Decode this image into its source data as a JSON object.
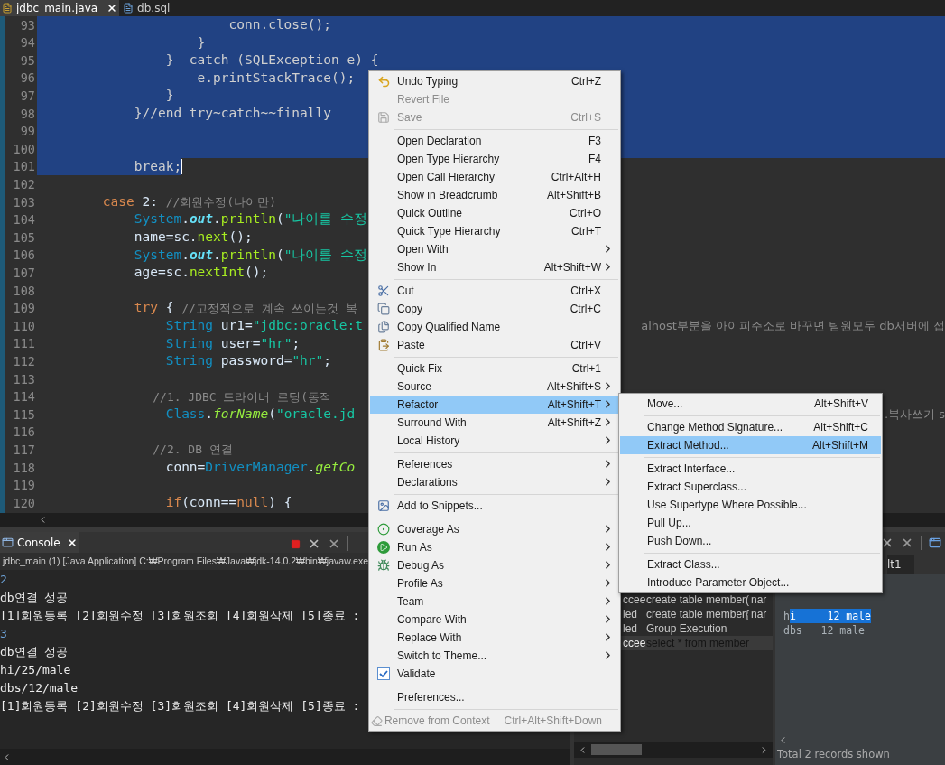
{
  "editor_tabs": [
    {
      "label": "jdbc_main.java",
      "selected": true
    },
    {
      "label": "db.sql",
      "selected": false
    }
  ],
  "code_lines": [
    {
      "number": "93",
      "selected": true,
      "cursor": false,
      "tokens": [
        {
          "kind": "plain",
          "text": "                        conn.close();"
        }
      ]
    },
    {
      "number": "94",
      "selected": true,
      "cursor": false,
      "tokens": [
        {
          "kind": "plain",
          "text": "                    }"
        }
      ]
    },
    {
      "number": "95",
      "selected": true,
      "cursor": false,
      "tokens": [
        {
          "kind": "plain",
          "text": "                }  catch (SQLException e) {"
        }
      ]
    },
    {
      "number": "96",
      "selected": true,
      "cursor": false,
      "tokens": [
        {
          "kind": "plain",
          "text": "                    e.printStackTrace();"
        }
      ]
    },
    {
      "number": "97",
      "selected": true,
      "cursor": false,
      "tokens": [
        {
          "kind": "plain",
          "text": "                }"
        }
      ]
    },
    {
      "number": "98",
      "selected": true,
      "cursor": false,
      "tokens": [
        {
          "kind": "plain",
          "text": "            }//end try~catch~~finally"
        }
      ]
    },
    {
      "number": "99",
      "selected": true,
      "cursor": false
    },
    {
      "number": "100",
      "selected": true,
      "cursor": false
    },
    {
      "number": "101",
      "selected": true,
      "cursor": true,
      "tokens": [
        {
          "kind": "plain",
          "text": "            break;"
        }
      ]
    },
    {
      "number": "102",
      "selected": false,
      "cursor": false
    },
    {
      "number": "103",
      "selected": false,
      "cursor": false,
      "tokens": [
        {
          "kind": "keyword",
          "text": "        case"
        },
        {
          "kind": "plain",
          "text": " 2: "
        },
        {
          "kind": "comment",
          "text": "//회원수정(나이만)"
        }
      ]
    },
    {
      "number": "104",
      "selected": false,
      "cursor": false,
      "tokens": [
        {
          "kind": "class",
          "text": "            System"
        },
        {
          "kind": "plain",
          "text": "."
        },
        {
          "kind": "field",
          "text": "out"
        },
        {
          "kind": "plain",
          "text": "."
        },
        {
          "kind": "method",
          "text": "println"
        },
        {
          "kind": "plain",
          "text": "("
        },
        {
          "kind": "string",
          "text": "\"나이를 수정"
        }
      ]
    },
    {
      "number": "105",
      "selected": false,
      "cursor": false,
      "tokens": [
        {
          "kind": "plain",
          "text": "            name=sc."
        },
        {
          "kind": "method",
          "text": "next"
        },
        {
          "kind": "plain",
          "text": "();"
        }
      ]
    },
    {
      "number": "106",
      "selected": false,
      "cursor": false,
      "tokens": [
        {
          "kind": "class",
          "text": "            System"
        },
        {
          "kind": "plain",
          "text": "."
        },
        {
          "kind": "field",
          "text": "out"
        },
        {
          "kind": "plain",
          "text": "."
        },
        {
          "kind": "method",
          "text": "println"
        },
        {
          "kind": "plain",
          "text": "("
        },
        {
          "kind": "string",
          "text": "\"나이를 수정"
        }
      ]
    },
    {
      "number": "107",
      "selected": false,
      "cursor": false,
      "tokens": [
        {
          "kind": "plain",
          "text": "            age=sc."
        },
        {
          "kind": "method",
          "text": "nextInt"
        },
        {
          "kind": "plain",
          "text": "();"
        }
      ]
    },
    {
      "number": "108",
      "selected": false,
      "cursor": false
    },
    {
      "number": "109",
      "selected": false,
      "cursor": false,
      "tokens": [
        {
          "kind": "keyword",
          "text": "            try"
        },
        {
          "kind": "plain",
          "text": " { "
        },
        {
          "kind": "comment",
          "text": "//고정적으로 계속 쓰이는것 복"
        }
      ]
    },
    {
      "number": "110",
      "selected": false,
      "cursor": false,
      "tokens": [
        {
          "kind": "class",
          "text": "                String"
        },
        {
          "kind": "plain",
          "text": " ur1="
        },
        {
          "kind": "string",
          "text": "\"jdbc:oracle:t"
        }
      ],
      "right": "alhost부분을 아이피주소로 바꾸면 팀원모두 db서버에 접"
    },
    {
      "number": "111",
      "selected": false,
      "cursor": false,
      "tokens": [
        {
          "kind": "class",
          "text": "                String"
        },
        {
          "kind": "plain",
          "text": " user="
        },
        {
          "kind": "string",
          "text": "\"hr\""
        },
        {
          "kind": "plain",
          "text": ";"
        }
      ]
    },
    {
      "number": "112",
      "selected": false,
      "cursor": false,
      "tokens": [
        {
          "kind": "class",
          "text": "                String"
        },
        {
          "kind": "plain",
          "text": " password="
        },
        {
          "kind": "string",
          "text": "\"hr\""
        },
        {
          "kind": "plain",
          "text": ";"
        }
      ]
    },
    {
      "number": "113",
      "selected": false,
      "cursor": false
    },
    {
      "number": "114",
      "selected": false,
      "cursor": false,
      "tokens": [
        {
          "kind": "comment",
          "text": "                //1. JDBC 드라이버 로딩(동적"
        }
      ]
    },
    {
      "number": "115",
      "selected": false,
      "cursor": false,
      "tokens": [
        {
          "kind": "class",
          "text": "                Class"
        },
        {
          "kind": "plain",
          "text": "."
        },
        {
          "kind": "static",
          "text": "forName"
        },
        {
          "kind": "plain",
          "text": "("
        },
        {
          "kind": "string",
          "text": "\"oracle.jd"
        }
      ],
      "right": ".복사쓰기 s"
    },
    {
      "number": "116",
      "selected": false,
      "cursor": false
    },
    {
      "number": "117",
      "selected": false,
      "cursor": false,
      "tokens": [
        {
          "kind": "comment",
          "text": "                //2. DB 연결"
        }
      ]
    },
    {
      "number": "118",
      "selected": false,
      "cursor": false,
      "tokens": [
        {
          "kind": "plain",
          "text": "                conn="
        },
        {
          "kind": "class",
          "text": "DriverManager"
        },
        {
          "kind": "plain",
          "text": "."
        },
        {
          "kind": "static",
          "text": "getCo"
        }
      ]
    },
    {
      "number": "119",
      "selected": false,
      "cursor": false
    },
    {
      "number": "120",
      "selected": false,
      "cursor": false,
      "tokens": [
        {
          "kind": "keyword",
          "text": "                if"
        },
        {
          "kind": "plain",
          "text": "(conn=="
        },
        {
          "kind": "keyword",
          "text": "null"
        },
        {
          "kind": "plain",
          "text": ") {"
        }
      ]
    }
  ],
  "console": {
    "tab": "Console",
    "process": "jdbc_main (1) [Java Application] C:₩Program Files₩Java₩jdk-14.0.2₩bin₩javaw.exe",
    "lines": [
      {
        "text": "2",
        "kind": "input"
      },
      {
        "text": "db연결 성공",
        "kind": "output"
      },
      {
        "text": "[1]회원등록 [2]회원수정 [3]회원조회 [4]회원삭제 [5]종료 :",
        "kind": "output"
      },
      {
        "text": "3",
        "kind": "input"
      },
      {
        "text": "db연결 성공",
        "kind": "output"
      },
      {
        "text": "hi/25/male",
        "kind": "output"
      },
      {
        "text": "dbs/12/male",
        "kind": "output"
      },
      {
        "text": "[1]회원등록 [2]회원수정 [3]회원조회 [4]회원삭제 [5]종료 :",
        "kind": "output"
      }
    ]
  },
  "sql_history": {
    "rows": [
      {
        "column_1": "ccee",
        "column_2": "create table member(",
        "column_3": "nar",
        "selected": false
      },
      {
        "column_1": "led",
        "column_2": "create table member{",
        "column_3": "nar",
        "selected": false
      },
      {
        "column_1": "led",
        "column_2": "Group Execution",
        "selected": false
      },
      {
        "column_1": "ccee",
        "column_2": "select * from member",
        "selected": true
      }
    ]
  },
  "result": {
    "tab": "lt1",
    "lines": [
      {
        "segments": [
          {
            "text": "---- --- ------",
            "selected": false
          }
        ]
      },
      {
        "segments": [
          {
            "text": "h",
            "selected": false
          },
          {
            "text": "i     12 male",
            "selected": true
          }
        ]
      },
      {
        "segments": [
          {
            "text": "dbs   12 male",
            "selected": false
          }
        ]
      }
    ],
    "status": "Total 2 records shown"
  },
  "context_menu": {
    "items": [
      {
        "kind": "item",
        "label": "Undo Typing",
        "shortcut": "Ctrl+Z",
        "submenu": false,
        "disabled": false,
        "selected": false
      },
      {
        "kind": "item",
        "label": "Revert File",
        "submenu": false,
        "disabled": true,
        "selected": false
      },
      {
        "kind": "item",
        "label": "Save",
        "shortcut": "Ctrl+S",
        "submenu": false,
        "disabled": true,
        "selected": false
      },
      {
        "kind": "separator"
      },
      {
        "kind": "item",
        "label": "Open Declaration",
        "shortcut": "F3",
        "submenu": false,
        "disabled": false,
        "selected": false
      },
      {
        "kind": "item",
        "label": "Open Type Hierarchy",
        "shortcut": "F4",
        "submenu": false,
        "disabled": false,
        "selected": false
      },
      {
        "kind": "item",
        "label": "Open Call Hierarchy",
        "shortcut": "Ctrl+Alt+H",
        "submenu": false,
        "disabled": false,
        "selected": false
      },
      {
        "kind": "item",
        "label": "Show in Breadcrumb",
        "shortcut": "Alt+Shift+B",
        "submenu": false,
        "disabled": false,
        "selected": false
      },
      {
        "kind": "item",
        "label": "Quick Outline",
        "shortcut": "Ctrl+O",
        "submenu": false,
        "disabled": false,
        "selected": false
      },
      {
        "kind": "item",
        "label": "Quick Type Hierarchy",
        "shortcut": "Ctrl+T",
        "submenu": false,
        "disabled": false,
        "selected": false
      },
      {
        "kind": "item",
        "label": "Open With",
        "submenu": true,
        "disabled": false,
        "selected": false
      },
      {
        "kind": "item",
        "label": "Show In",
        "shortcut": "Alt+Shift+W",
        "submenu": true,
        "disabled": false,
        "selected": false
      },
      {
        "kind": "separator"
      },
      {
        "kind": "item",
        "label": "Cut",
        "shortcut": "Ctrl+X",
        "submenu": false,
        "disabled": false,
        "selected": false
      },
      {
        "kind": "item",
        "label": "Copy",
        "shortcut": "Ctrl+C",
        "submenu": false,
        "disabled": false,
        "selected": false
      },
      {
        "kind": "item",
        "label": "Copy Qualified Name",
        "submenu": false,
        "disabled": false,
        "selected": false
      },
      {
        "kind": "item",
        "label": "Paste",
        "shortcut": "Ctrl+V",
        "submenu": false,
        "disabled": false,
        "selected": false
      },
      {
        "kind": "separator"
      },
      {
        "kind": "item",
        "label": "Quick Fix",
        "shortcut": "Ctrl+1",
        "submenu": false,
        "disabled": false,
        "selected": false
      },
      {
        "kind": "item",
        "label": "Source",
        "shortcut": "Alt+Shift+S",
        "submenu": true,
        "disabled": false,
        "selected": false
      },
      {
        "kind": "item",
        "label": "Refactor",
        "shortcut": "Alt+Shift+T",
        "submenu": true,
        "disabled": false,
        "selected": true
      },
      {
        "kind": "item",
        "label": "Surround With",
        "shortcut": "Alt+Shift+Z",
        "submenu": true,
        "disabled": false,
        "selected": false
      },
      {
        "kind": "item",
        "label": "Local History",
        "submenu": true,
        "disabled": false,
        "selected": false
      },
      {
        "kind": "separator"
      },
      {
        "kind": "item",
        "label": "References",
        "submenu": true,
        "disabled": false,
        "selected": false
      },
      {
        "kind": "item",
        "label": "Declarations",
        "submenu": true,
        "disabled": false,
        "selected": false
      },
      {
        "kind": "separator"
      },
      {
        "kind": "item",
        "label": "Add to Snippets...",
        "submenu": false,
        "disabled": false,
        "selected": false
      },
      {
        "kind": "separator"
      },
      {
        "kind": "item",
        "label": "Coverage As",
        "submenu": true,
        "disabled": false,
        "selected": false
      },
      {
        "kind": "item",
        "label": "Run As",
        "submenu": true,
        "disabled": false,
        "selected": false
      },
      {
        "kind": "item",
        "label": "Debug As",
        "submenu": true,
        "disabled": false,
        "selected": false
      },
      {
        "kind": "item",
        "label": "Profile As",
        "submenu": true,
        "disabled": false,
        "selected": false
      },
      {
        "kind": "item",
        "label": "Team",
        "submenu": true,
        "disabled": false,
        "selected": false
      },
      {
        "kind": "item",
        "label": "Compare With",
        "submenu": true,
        "disabled": false,
        "selected": false
      },
      {
        "kind": "item",
        "label": "Replace With",
        "submenu": true,
        "disabled": false,
        "selected": false
      },
      {
        "kind": "item",
        "label": "Switch to Theme...",
        "submenu": true,
        "disabled": false,
        "selected": false
      },
      {
        "kind": "check",
        "label": "Validate",
        "checked": true,
        "submenu": false,
        "disabled": false,
        "selected": false
      },
      {
        "kind": "separator"
      },
      {
        "kind": "item",
        "label": "Preferences...",
        "submenu": false,
        "disabled": false,
        "selected": false
      },
      {
        "kind": "separator"
      },
      {
        "kind": "item",
        "label": "Remove from Context",
        "shortcut": "Ctrl+Alt+Shift+Down",
        "submenu": false,
        "disabled": true,
        "selected": false
      }
    ]
  },
  "refactor_submenu": {
    "items": [
      {
        "kind": "item",
        "label": "Move...",
        "shortcut": "Alt+Shift+V",
        "selected": false
      },
      {
        "kind": "separator"
      },
      {
        "kind": "item",
        "label": "Change Method Signature...",
        "shortcut": "Alt+Shift+C",
        "selected": false
      },
      {
        "kind": "item",
        "label": "Extract Method...",
        "shortcut": "Alt+Shift+M",
        "selected": true
      },
      {
        "kind": "separator"
      },
      {
        "kind": "item",
        "label": "Extract Interface...",
        "selected": false
      },
      {
        "kind": "item",
        "label": "Extract Superclass...",
        "selected": false
      },
      {
        "kind": "item",
        "label": "Use Supertype Where Possible...",
        "selected": false
      },
      {
        "kind": "item",
        "label": "Pull Up...",
        "selected": false
      },
      {
        "kind": "item",
        "label": "Push Down...",
        "selected": false
      },
      {
        "kind": "separator"
      },
      {
        "kind": "item",
        "label": "Extract Class...",
        "selected": false
      },
      {
        "kind": "item",
        "label": "Introduce Parameter Object...",
        "selected": false
      }
    ]
  }
}
